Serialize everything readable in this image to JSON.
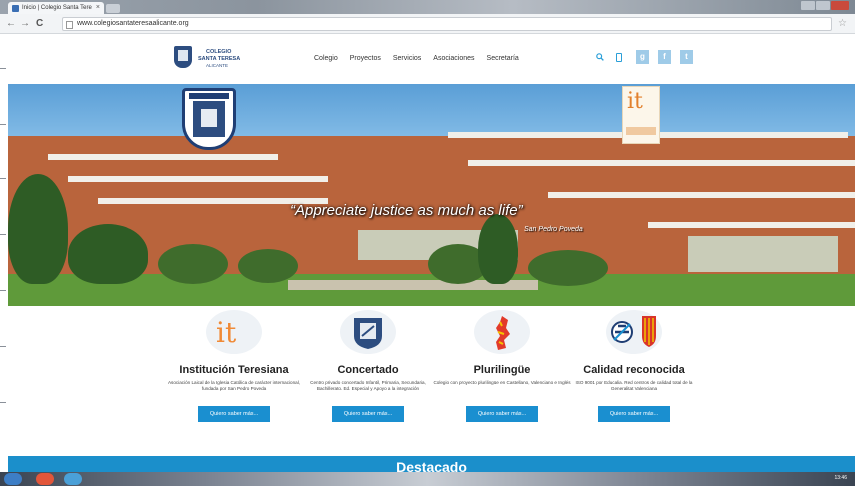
{
  "browser": {
    "tab_title": "Inicio | Colegio Santa Tere",
    "tab_close": "×",
    "url": "www.colegiosantateresaalicante.org",
    "back": "←",
    "forward": "→",
    "reload": "C",
    "bookmark": "☆"
  },
  "site": {
    "logo": {
      "line1": "COLEGIO",
      "line2": "SANTA TERESA",
      "line3": "ALICANTE"
    },
    "menu": [
      "Colegio",
      "Proyectos",
      "Servicios",
      "Asociaciones",
      "Secretaría"
    ],
    "social": [
      {
        "name": "google-plus",
        "glyph": "g"
      },
      {
        "name": "facebook",
        "glyph": "f"
      },
      {
        "name": "twitter",
        "glyph": "t"
      }
    ],
    "accent_color": "#1a8fd0"
  },
  "hero": {
    "quote": "“Appreciate justice as much as life”",
    "author": "San Pedro Poveda",
    "banner_glyph": "it"
  },
  "features": [
    {
      "title": "Institución Teresiana",
      "text": "Asociación Laical de la Iglesia Católica de carácter internacional, fundada por San Pedro Poveda",
      "button": "Quiero saber más..."
    },
    {
      "title": "Concertado",
      "text": "Centro privado concertado Infantil, Primaria, Secundaria, Bachillerato. Ed. Especial y Apoyo a la integración",
      "button": "Quiero saber más..."
    },
    {
      "title": "Plurilingüe",
      "text": "Colegio con proyecto plurilingüe en Castellano, Valenciano e Inglés",
      "button": "Quiero saber más..."
    },
    {
      "title": "Calidad reconocida",
      "text": "ISO 9001 por Educalia. Red centros de calidad total de la Generalitat Valenciana",
      "button": "Quiero saber más..."
    }
  ],
  "feature_glyphs": [
    "it"
  ],
  "destacado": "Destacado",
  "taskbar": {
    "clock": "13:46"
  }
}
